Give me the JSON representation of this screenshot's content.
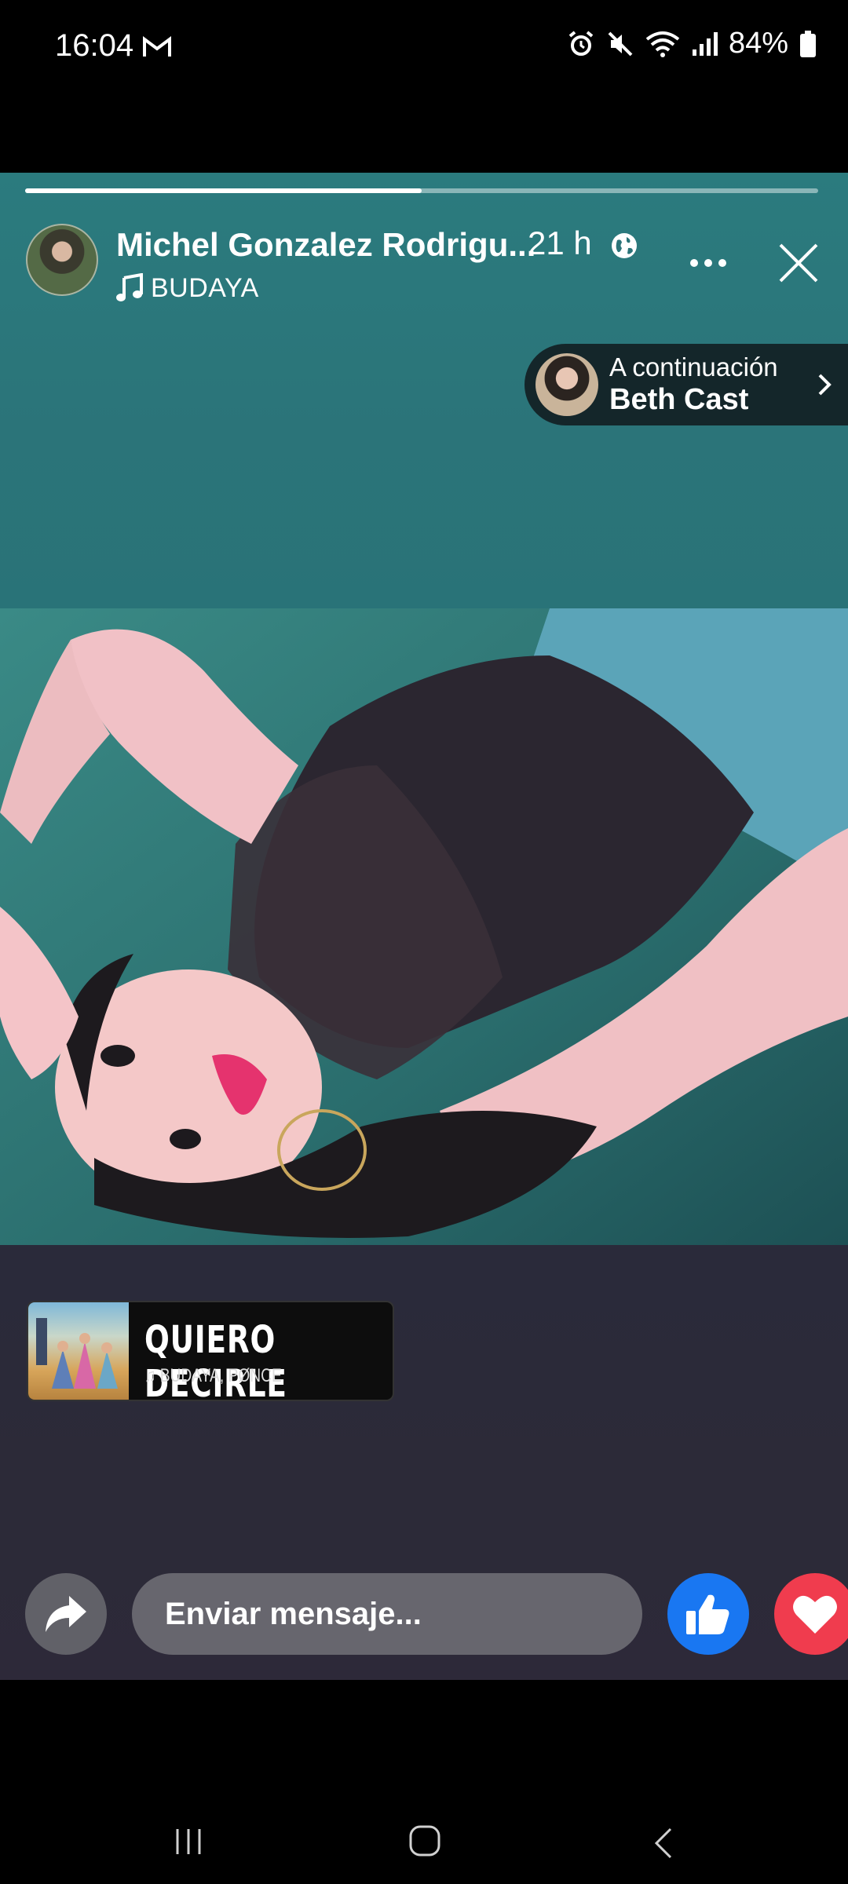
{
  "status_bar": {
    "time": "16:04",
    "battery": "84%"
  },
  "story": {
    "progress": 0.5,
    "author": "Michel Gonzalez Rodrigu...",
    "time_ago": "21 h",
    "music_label": "BUDAYA",
    "next": {
      "label": "A continuación",
      "name": "Beth Cast"
    },
    "sticker": {
      "title": "QUIERO DECIRLE",
      "artists": "♫ BUDAYA, PØNCE"
    }
  },
  "bottom_bar": {
    "message_placeholder": "Enviar mensaje..."
  },
  "colors": {
    "like": "#1977f2",
    "love": "#f03c4e",
    "story_top": "#2b7b7e",
    "story_bottom": "#2a2a38"
  }
}
